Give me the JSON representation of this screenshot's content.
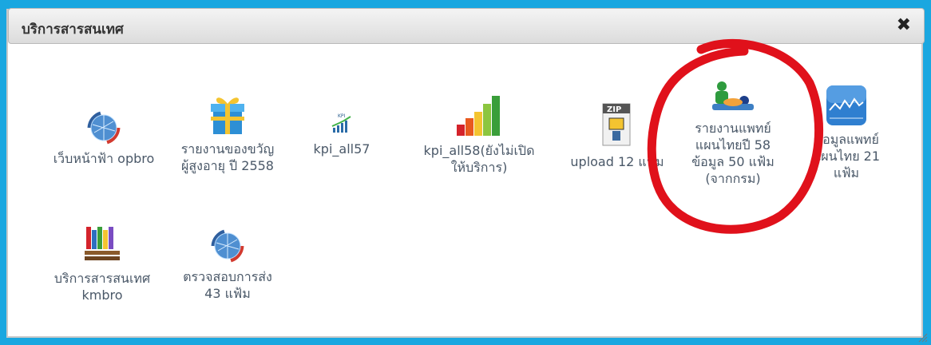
{
  "dialog": {
    "title": "บริการสารสนเทศ",
    "close_label": "✖"
  },
  "items": [
    {
      "label_lines": [
        "เว็บหน้าฟ้า opbro"
      ],
      "icon": "globe-icon"
    },
    {
      "label_lines": [
        "รายงานของขวัญ",
        "ผู้สูงอายุ ปี 2558"
      ],
      "icon": "gift-icon"
    },
    {
      "label_lines": [
        "kpi_all57"
      ],
      "icon": "kpi-chart-icon"
    },
    {
      "label_lines": [
        "kpi_all58(ยังไม่เปิด",
        "ให้บริการ)"
      ],
      "icon": "bar-chart-icon"
    },
    {
      "label_lines": [
        "upload 12 แฟ้ม"
      ],
      "icon": "zip-file-icon"
    },
    {
      "label_lines": [
        "รายงานแพทย์",
        "แผนไทยปี 58",
        "ข้อมูล 50 แฟ้ม",
        "(จากกรม)"
      ],
      "icon": "massage-icon"
    },
    {
      "label_lines": [
        "ข้อมูลแพทย์",
        "แผนไทย 21",
        "แฟ้ม"
      ],
      "icon": "stock-chart-icon"
    },
    {
      "label_lines": [
        "บริการสารสนเทศ",
        "kmbro"
      ],
      "icon": "books-icon"
    },
    {
      "label_lines": [
        "ตรวจสอบการส่ง",
        "43 แฟ้ม"
      ],
      "icon": "globe-icon"
    }
  ],
  "colors": {
    "frame": "#1aa7e0",
    "annotation": "#e0111b",
    "label_text": "#4a5868"
  }
}
